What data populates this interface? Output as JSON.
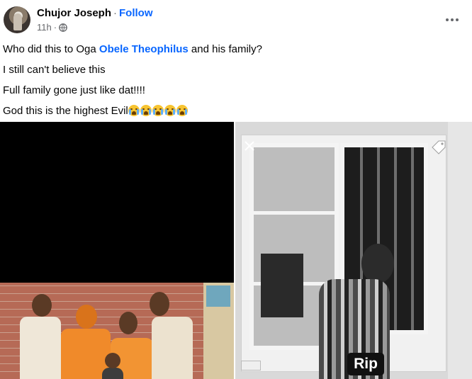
{
  "post": {
    "author": "Chujor Joseph",
    "separator": "·",
    "follow_label": "Follow",
    "time": "11h",
    "meta_separator": "·",
    "privacy_icon": "globe-icon",
    "more_icon": "more-options-icon"
  },
  "body": {
    "line1_prefix": "Who did this to Oga ",
    "line1_mention": "Obele Theophilus",
    "line1_suffix": " and his family?",
    "line2": "I still can't believe this",
    "line3": "Full family gone just like dat!!!!",
    "line4": "God this is the highest Evil",
    "line4_emoji": "loudly-crying-face",
    "line4_emoji_count": 5
  },
  "media": {
    "left_photo": "family-photo",
    "right_photo": "young-man-photo",
    "right_caption": "Rip",
    "close_icon": "close-icon",
    "tag_icon": "tag-icon"
  },
  "colors": {
    "link": "#0866ff",
    "meta": "#65676b",
    "text": "#050505"
  }
}
